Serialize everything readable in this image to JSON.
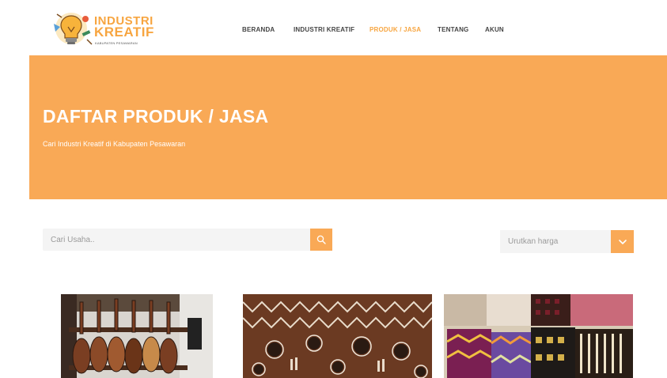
{
  "brand": {
    "line1": "INDUSTRI",
    "line2": "KREATIF",
    "subtitle": "KABUPATEN PESAWARAN"
  },
  "nav": {
    "items": [
      {
        "label": "BERANDA",
        "active": false
      },
      {
        "label": "INDUSTRI KREATIF",
        "active": false
      },
      {
        "label": "PRODUK / JASA",
        "active": true
      },
      {
        "label": "TENTANG",
        "active": false
      },
      {
        "label": "AKUN",
        "active": false
      }
    ]
  },
  "hero": {
    "title": "DAFTAR PRODUK / JASA",
    "subtitle": "Cari Industri Kreatif di Kabupaten Pesawaran"
  },
  "search": {
    "placeholder": "Cari Usaha.."
  },
  "sort": {
    "selected": "Urutkan harga"
  },
  "products": [
    {
      "image": "guitars-photo"
    },
    {
      "image": "tapis-fabric-photo"
    },
    {
      "image": "woven-textiles-photo"
    }
  ],
  "colors": {
    "accent": "#f9a956",
    "nav_active": "#f7a540",
    "nav_text": "#444444"
  }
}
